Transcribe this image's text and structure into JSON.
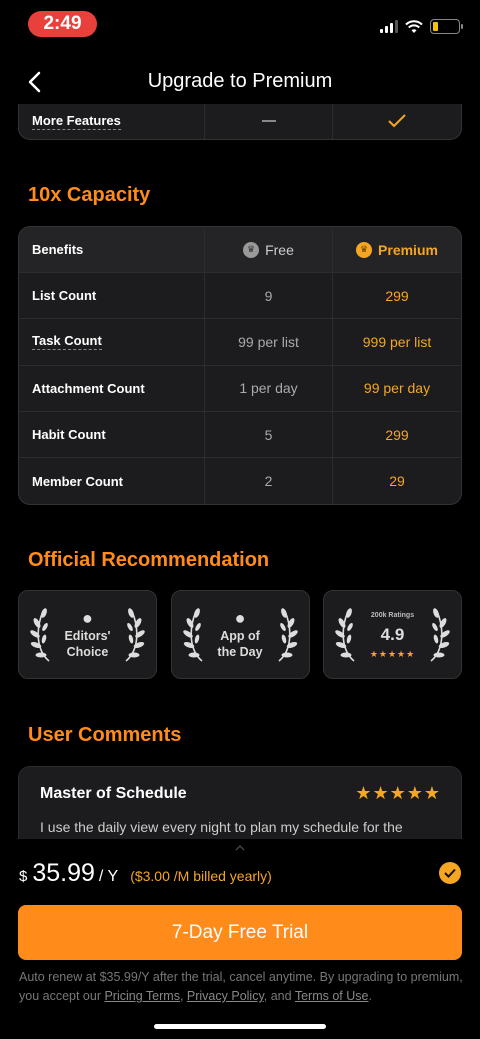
{
  "status_bar": {
    "time": "2:49"
  },
  "nav": {
    "title": "Upgrade to Premium"
  },
  "partial_row": {
    "label": "More Features"
  },
  "capacity": {
    "title": "10x Capacity",
    "headers": {
      "benefits": "Benefits",
      "free": "Free",
      "premium": "Premium"
    },
    "rows": [
      {
        "label": "List Count",
        "free": "9",
        "premium": "299"
      },
      {
        "label": "Task Count",
        "free": "99 per list",
        "premium": "999 per list"
      },
      {
        "label": "Attachment Count",
        "free": "1 per day",
        "premium": "99 per day"
      },
      {
        "label": "Habit Count",
        "free": "5",
        "premium": "299"
      },
      {
        "label": "Member Count",
        "free": "2",
        "premium": "29"
      }
    ]
  },
  "recommendation": {
    "title": "Official Recommendation",
    "badges": [
      {
        "line1": "Editors'",
        "line2": "Choice"
      },
      {
        "line1": "App of",
        "line2": "the Day"
      },
      {
        "ratings": "200k Ratings",
        "score": "4.9",
        "stars": "★★★★★"
      }
    ]
  },
  "comments": {
    "title": "User Comments",
    "items": [
      {
        "title": "Master of Schedule",
        "stars": "★★★★★",
        "text": "I use the daily view every night to plan my schedule for the"
      }
    ]
  },
  "purchase": {
    "currency": "$",
    "price": "35.99",
    "period": "/ Y",
    "billed": "($3.00 /M billed yearly)",
    "cta": "7-Day Free Trial",
    "legal_prefix": "Auto renew at $35.99/Y after the trial, cancel anytime. By upgrading to premium, you accept our ",
    "pricing_terms": "Pricing Terms",
    "comma": ", ",
    "privacy_policy": "Privacy Policy",
    "and": ", and ",
    "terms_of_use": "Terms of Use",
    "period_end": "."
  },
  "colors": {
    "accent": "#ff8c1a",
    "gold": "#f5a623",
    "card": "#1c1c1e",
    "status_pill": "#e8403a"
  }
}
